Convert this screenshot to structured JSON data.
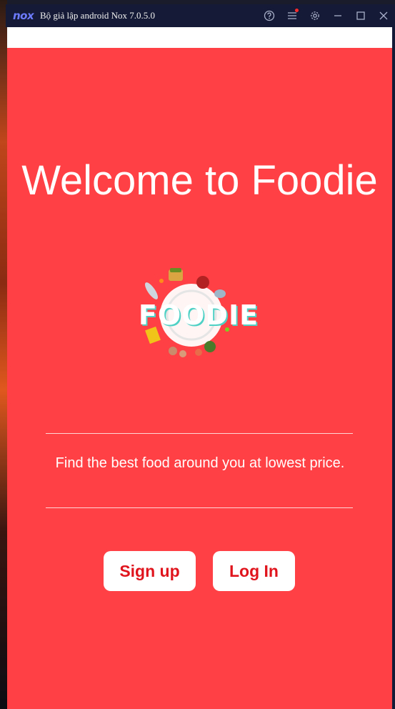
{
  "window": {
    "logo": "nox",
    "title": "Bộ giả lập android Nox 7.0.5.0",
    "icons": [
      "help-icon",
      "menu-icon",
      "settings-icon",
      "minimize-icon",
      "maximize-icon",
      "close-icon"
    ]
  },
  "app": {
    "welcome_title": "Welcome to Foodie",
    "logo_text": "FOODIE",
    "tagline": "Find the best food around you at lowest price.",
    "signup_label": "Sign up",
    "login_label": "Log In"
  },
  "colors": {
    "screen_background": "#ff4044",
    "button_text": "#e0141c",
    "titlebar": "#151b36"
  }
}
